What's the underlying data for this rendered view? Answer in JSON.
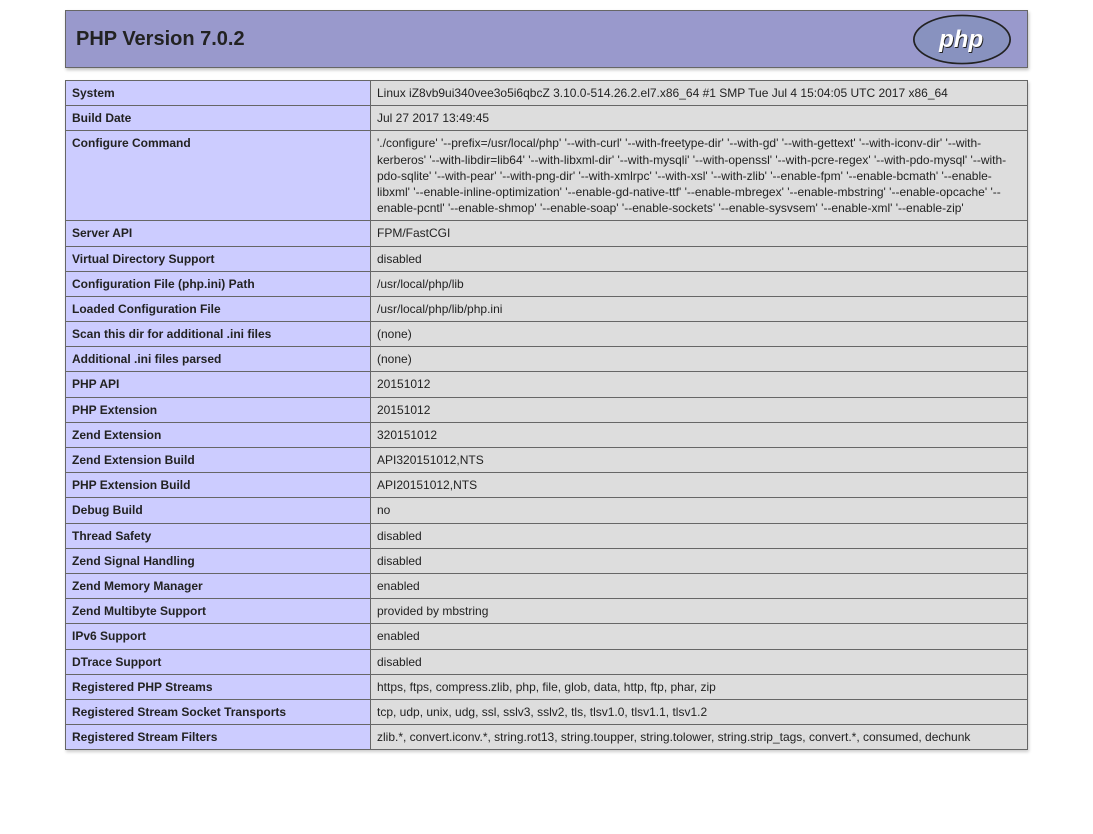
{
  "header": {
    "title": "PHP Version 7.0.2"
  },
  "rows": [
    {
      "label": "System",
      "value": "Linux iZ8vb9ui340vee3o5i6qbcZ 3.10.0-514.26.2.el7.x86_64 #1 SMP Tue Jul 4 15:04:05 UTC 2017 x86_64"
    },
    {
      "label": "Build Date",
      "value": "Jul 27 2017 13:49:45"
    },
    {
      "label": "Configure Command",
      "value": "'./configure' '--prefix=/usr/local/php' '--with-curl' '--with-freetype-dir' '--with-gd' '--with-gettext' '--with-iconv-dir' '--with-kerberos' '--with-libdir=lib64' '--with-libxml-dir' '--with-mysqli' '--with-openssl' '--with-pcre-regex' '--with-pdo-mysql' '--with-pdo-sqlite' '--with-pear' '--with-png-dir' '--with-xmlrpc' '--with-xsl' '--with-zlib' '--enable-fpm' '--enable-bcmath' '--enable-libxml' '--enable-inline-optimization' '--enable-gd-native-ttf' '--enable-mbregex' '--enable-mbstring' '--enable-opcache' '--enable-pcntl' '--enable-shmop' '--enable-soap' '--enable-sockets' '--enable-sysvsem' '--enable-xml' '--enable-zip'"
    },
    {
      "label": "Server API",
      "value": "FPM/FastCGI"
    },
    {
      "label": "Virtual Directory Support",
      "value": "disabled"
    },
    {
      "label": "Configuration File (php.ini) Path",
      "value": "/usr/local/php/lib"
    },
    {
      "label": "Loaded Configuration File",
      "value": "/usr/local/php/lib/php.ini"
    },
    {
      "label": "Scan this dir for additional .ini files",
      "value": "(none)"
    },
    {
      "label": "Additional .ini files parsed",
      "value": "(none)"
    },
    {
      "label": "PHP API",
      "value": "20151012"
    },
    {
      "label": "PHP Extension",
      "value": "20151012"
    },
    {
      "label": "Zend Extension",
      "value": "320151012"
    },
    {
      "label": "Zend Extension Build",
      "value": "API320151012,NTS"
    },
    {
      "label": "PHP Extension Build",
      "value": "API20151012,NTS"
    },
    {
      "label": "Debug Build",
      "value": "no"
    },
    {
      "label": "Thread Safety",
      "value": "disabled"
    },
    {
      "label": "Zend Signal Handling",
      "value": "disabled"
    },
    {
      "label": "Zend Memory Manager",
      "value": "enabled"
    },
    {
      "label": "Zend Multibyte Support",
      "value": "provided by mbstring"
    },
    {
      "label": "IPv6 Support",
      "value": "enabled"
    },
    {
      "label": "DTrace Support",
      "value": "disabled"
    },
    {
      "label": "Registered PHP Streams",
      "value": "https, ftps, compress.zlib, php, file, glob, data, http, ftp, phar, zip"
    },
    {
      "label": "Registered Stream Socket Transports",
      "value": "tcp, udp, unix, udg, ssl, sslv3, sslv2, tls, tlsv1.0, tlsv1.1, tlsv1.2"
    },
    {
      "label": "Registered Stream Filters",
      "value": "zlib.*, convert.iconv.*, string.rot13, string.toupper, string.tolower, string.strip_tags, convert.*, consumed, dechunk"
    }
  ]
}
